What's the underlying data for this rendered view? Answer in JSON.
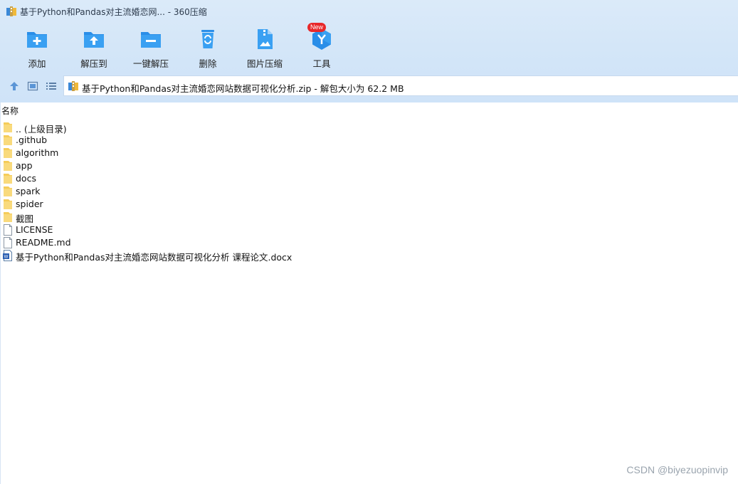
{
  "window": {
    "title": "基于Python和Pandas对主流婚恋网... - 360压缩",
    "app_icon": "archive-app-icon"
  },
  "toolbar": {
    "items": [
      {
        "label": "添加",
        "icon": "add-folder-icon"
      },
      {
        "label": "解压到",
        "icon": "extract-to-icon"
      },
      {
        "label": "一键解压",
        "icon": "one-click-extract-icon"
      },
      {
        "label": "删除",
        "icon": "trash-icon"
      },
      {
        "label": "图片压缩",
        "icon": "image-compress-icon"
      },
      {
        "label": "工具",
        "icon": "tools-icon",
        "badge": "New"
      }
    ]
  },
  "navbar": {
    "path": "基于Python和Pandas对主流婚恋网站数据可视化分析.zip - 解包大小为 62.2 MB"
  },
  "list": {
    "column_name": "名称",
    "rows": [
      {
        "name": ".. (上级目录)",
        "type": "folder"
      },
      {
        "name": ".github",
        "type": "folder"
      },
      {
        "name": "algorithm",
        "type": "folder"
      },
      {
        "name": "app",
        "type": "folder"
      },
      {
        "name": "docs",
        "type": "folder"
      },
      {
        "name": "spark",
        "type": "folder"
      },
      {
        "name": "spider",
        "type": "folder"
      },
      {
        "name": "截图",
        "type": "folder"
      },
      {
        "name": "LICENSE",
        "type": "file"
      },
      {
        "name": "README.md",
        "type": "file"
      },
      {
        "name": "基于Python和Pandas对主流婚恋网站数据可视化分析 课程论文.docx",
        "type": "docx"
      }
    ]
  },
  "watermark": "CSDN @biyezuopinvip",
  "colors": {
    "accent": "#2a8ee8",
    "toolbar_bg": "#d4e6f8",
    "folder": "#f5cc5a",
    "badge": "#e8282a"
  }
}
